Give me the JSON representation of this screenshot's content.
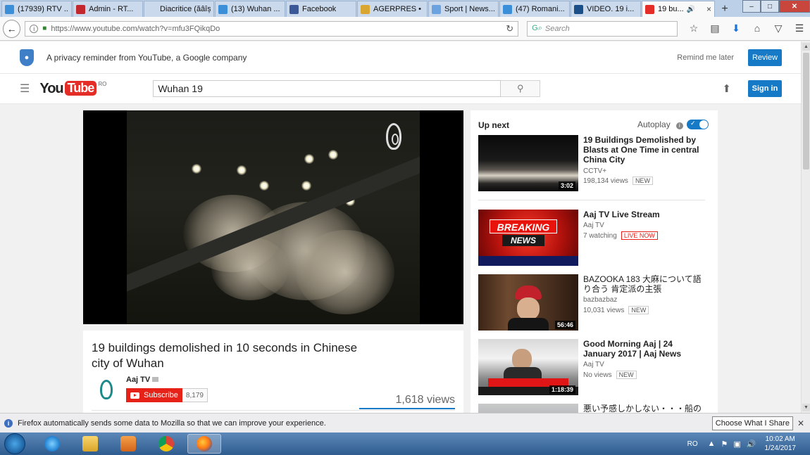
{
  "browser": {
    "tabs": [
      {
        "label": "(17939) RTV ...",
        "icon": "twitter-icon",
        "color": "#3a8fd8"
      },
      {
        "label": "Admin - RT...",
        "icon": "rtv-icon",
        "color": "#c2272d"
      },
      {
        "label": "Diacritice (ăâîșț) ...",
        "icon": "page-icon",
        "color": "#cad9ec"
      },
      {
        "label": "(13) Wuhan ...",
        "icon": "twitter-icon",
        "color": "#3a8fd8"
      },
      {
        "label": "Facebook",
        "icon": "facebook-icon",
        "color": "#3b5998"
      },
      {
        "label": "AGERPRES • ...",
        "icon": "agerpres-icon",
        "color": "#d9a632"
      },
      {
        "label": "Sport | News...",
        "icon": "news-icon",
        "color": "#6aa3e0"
      },
      {
        "label": "(47) Romani...",
        "icon": "twitter-icon",
        "color": "#3a8fd8"
      },
      {
        "label": "VIDEO. 19 i...",
        "icon": "video-icon",
        "color": "#1a4f8a"
      },
      {
        "label": "19 bu...",
        "icon": "youtube-icon",
        "color": "#e52d27",
        "active": true
      }
    ],
    "new_tab": "+",
    "url": "https://www.youtube.com/watch?v=mfu3FQikqDo",
    "search_placeholder": "Search"
  },
  "privacy_banner": {
    "text": "A privacy reminder from YouTube, a Google company",
    "remind_label": "Remind me later",
    "review_label": "Review"
  },
  "youtube_header": {
    "logo_you": "You",
    "logo_tube": "Tube",
    "region": "RO",
    "search_value": "Wuhan 19",
    "signin_label": "Sign in"
  },
  "video": {
    "title": "19 buildings demolished in 10 seconds in Chinese city of Wuhan",
    "channel": "Aaj TV",
    "subscribe_label": "Subscribe",
    "subscriber_count": "8,179",
    "views": "1,618 views"
  },
  "sidebar": {
    "up_next": "Up next",
    "autoplay": "Autoplay",
    "autoplay_on": true,
    "items": [
      {
        "title": "19 Buildings Demolished by Blasts at One Time in central China City",
        "channel": "CCTV+",
        "meta": "198,134 views",
        "badge": "NEW",
        "duration": "3:02"
      },
      {
        "title": "Aaj TV Live Stream",
        "channel": "Aaj TV",
        "meta": "7 watching",
        "badge": "LIVE NOW",
        "duration": ""
      },
      {
        "title": "BAZOOKA 183 大麻について語り合う 肯定派の主張",
        "channel": "bazbazbaz",
        "meta": "10,031 views",
        "badge": "NEW",
        "duration": "56:46"
      },
      {
        "title": "Good Morning Aaj | 24 January 2017 | Aaj News",
        "channel": "Aaj TV",
        "meta": "No views",
        "badge": "NEW",
        "duration": "1:18:39"
      },
      {
        "title": "悪い予感しかしない・・・船のトラブ",
        "channel": "",
        "meta": "",
        "badge": "",
        "duration": ""
      }
    ],
    "breaking_top": "BREAKING",
    "breaking_bottom": "NEWS"
  },
  "notification": {
    "text": "Firefox automatically sends some data to Mozilla so that we can improve your experience.",
    "button": "Choose What I Share"
  },
  "taskbar": {
    "language": "RO",
    "time": "10:02 AM",
    "date": "1/24/2017"
  }
}
